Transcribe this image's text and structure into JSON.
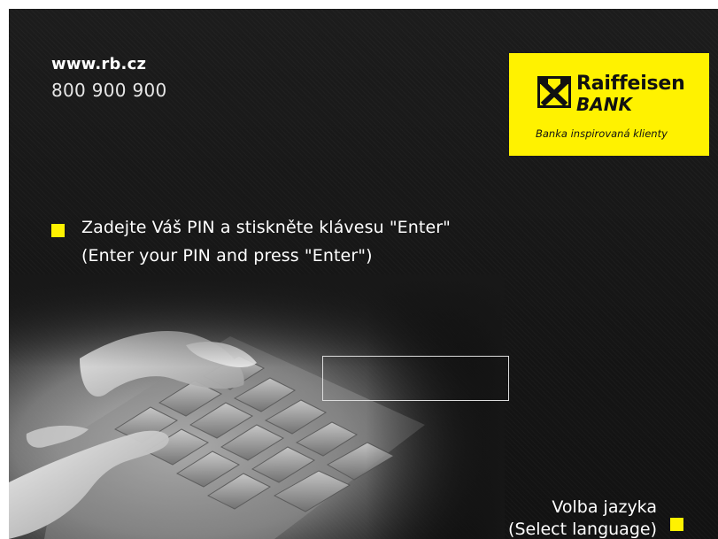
{
  "header": {
    "url": "www.rb.cz",
    "phone": "800 900 900"
  },
  "logo": {
    "emblem_icon": "raiffeisen-gable-cross-icon",
    "name_line_1": "Raiffeisen",
    "name_line_2": "BANK",
    "tagline": "Banka inspirovaná klienty",
    "background_color": "#fff200"
  },
  "instruction": {
    "line_1": "Zadejte Váš PIN a stiskněte klávesu \"Enter\"",
    "line_2": "(Enter your PIN and press \"Enter\")"
  },
  "pin_field": {
    "value": ""
  },
  "language": {
    "line_1": "Volba jazyka",
    "line_2": "(Select language)"
  },
  "colors": {
    "accent": "#fff200",
    "background": "#1a1a1a",
    "text": "#ffffff"
  }
}
